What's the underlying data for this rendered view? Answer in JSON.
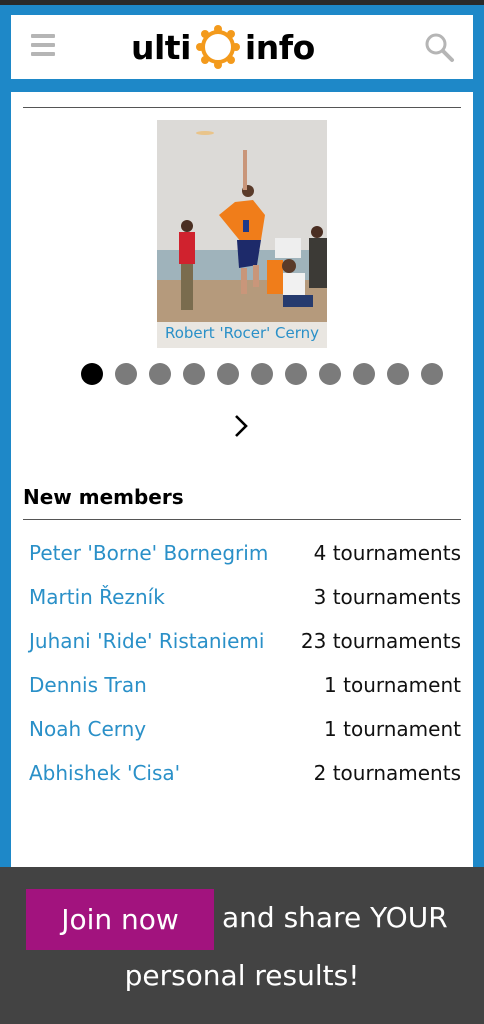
{
  "header": {
    "logo_left": "ulti",
    "logo_right": "info",
    "icons": {
      "menu": "hamburger-menu-icon",
      "search": "search-icon",
      "logo": "ring-logo-icon"
    },
    "brand_color": "#1e88c8",
    "logo_accent": "#f39a1c"
  },
  "spotlight": {
    "caption": "Robert 'Rocer' Cerny",
    "slide_count": 11,
    "active_slide": 1
  },
  "new_members": {
    "title": "New members",
    "items": [
      {
        "name": "Peter 'Borne' Bornegrim",
        "count": "4 tournaments"
      },
      {
        "name": "Martin Řezník",
        "count": "3 tournaments"
      },
      {
        "name": "Juhani 'Ride' Ristaniemi",
        "count": "23 tournaments"
      },
      {
        "name": "Dennis Tran",
        "count": "1 tournament"
      },
      {
        "name": "Noah Cerny",
        "count": "1 tournament"
      },
      {
        "name": "Abhishek 'Cisa'",
        "count": "2 tournaments"
      }
    ]
  },
  "join_banner": {
    "button_label": "Join now",
    "text_line1": "and share YOUR",
    "text_line2": "personal results!",
    "button_color": "#a2137e"
  }
}
